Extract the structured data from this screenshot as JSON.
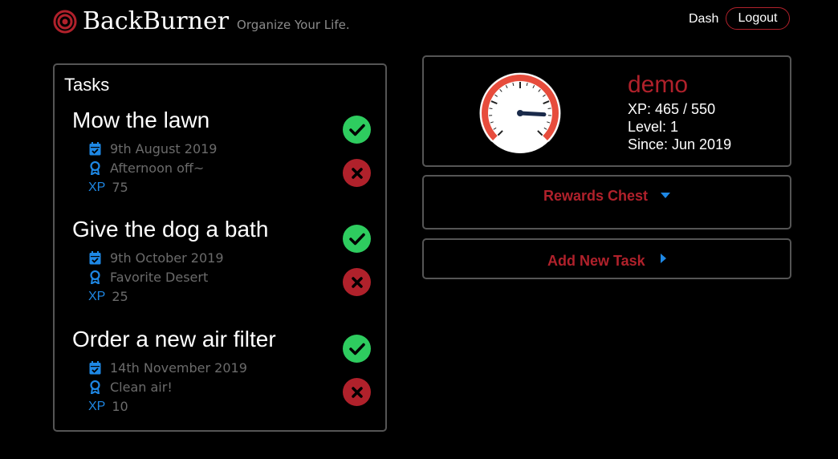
{
  "brand": {
    "name": "BackBurner",
    "tagline": "Organize Your Life."
  },
  "nav": {
    "dash": "Dash",
    "logout": "Logout"
  },
  "tasks": {
    "title": "Tasks",
    "xp_tag": "XP",
    "items": [
      {
        "title": "Mow the lawn",
        "date": "9th August 2019",
        "reward": "Afternoon off~",
        "xp": "75"
      },
      {
        "title": "Give the dog a bath",
        "date": "9th October 2019",
        "reward": "Favorite Desert",
        "xp": "25"
      },
      {
        "title": "Order a new air filter",
        "date": "14th November 2019",
        "reward": "Clean air!",
        "xp": "10"
      }
    ]
  },
  "profile": {
    "username": "demo",
    "xp": "XP: 465 / 550",
    "level": "Level: 1",
    "since": "Since: Jun 2019",
    "xp_progress": 0.845
  },
  "rewards": {
    "label": "Rewards Chest"
  },
  "add_task": {
    "label": "Add New Task"
  },
  "colors": {
    "background": "#000000",
    "accent_red": "#b0212b",
    "success_green": "#2ecc5f",
    "icon_blue": "#1e88e5",
    "muted_text": "#6b6b6b",
    "border_gray": "#555555"
  },
  "icons": {
    "logo": "target-icon",
    "date": "calendar-check-icon",
    "reward": "ribbon-award-icon",
    "complete": "check-circle-icon",
    "delete": "x-circle-icon",
    "dropdown": "caret-down-icon",
    "expand": "caret-right-icon",
    "gauge": "speedometer-icon"
  }
}
